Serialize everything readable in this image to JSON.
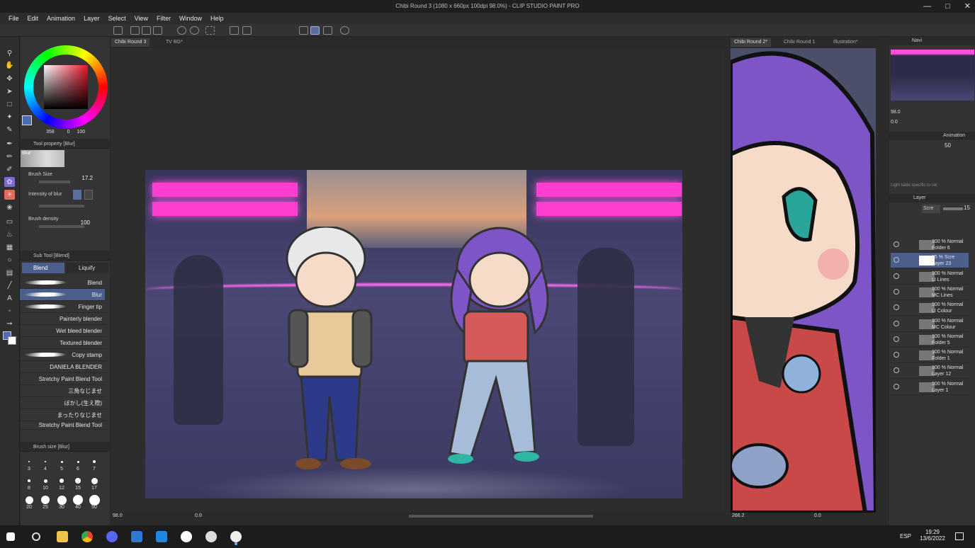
{
  "window": {
    "title": "Chibi Round 3 (1080 x 660px 100dpi 98.0%) - CLIP STUDIO PAINT PRO"
  },
  "menu": [
    "File",
    "Edit",
    "Animation",
    "Layer",
    "Select",
    "View",
    "Filter",
    "Window",
    "Help"
  ],
  "tabs": {
    "left": [
      "Chibi Round 3",
      "TV BG*"
    ],
    "right": [
      "Chibi Round 2*",
      "Chibi Round 1",
      "Illustration*"
    ]
  },
  "color": {
    "h": "358",
    "s": "0",
    "v": "100",
    "accent": "#e8132a"
  },
  "tool_property": {
    "title": "Tool property [Blur]",
    "tool": "Blur",
    "brush_size_label": "Brush Size",
    "brush_size": "17.2",
    "intensity_label": "Intensity of blur",
    "density_label": "Brush density",
    "density": "100"
  },
  "sub_tool": {
    "title": "Sub Tool [Blend]",
    "tabs": [
      "Blend",
      "Liquify"
    ],
    "items": [
      "Blend",
      "Blur",
      "Finger tip",
      "Painterly blender",
      "Wet bleed blender",
      "Textured blender",
      "Copy stamp",
      "DANIELA BLENDER",
      "Stretchy Paint Blend Tool",
      "三角なじませ",
      "ぼかし(生え際)",
      "まったりなじませ",
      "Stretchy Paint Blend Tool"
    ]
  },
  "brush_size": {
    "title": "Brush size [Blur]",
    "sizes": [
      "3",
      "4",
      "5",
      "6",
      "7",
      "8",
      "10",
      "12",
      "15",
      "17",
      "20",
      "25",
      "30",
      "40",
      "50"
    ]
  },
  "status": {
    "zoom": "98.0",
    "angle": "0.0",
    "zoom_right": "266.2",
    "angle_right": "0.0"
  },
  "navigator": {
    "tab": "Navi",
    "zoom": "98.0",
    "angle": "0.0"
  },
  "animation": {
    "tab": "Animation",
    "value": "50",
    "hint": "Light table specific to cel"
  },
  "layers": {
    "tab": "Layer",
    "blend": "Scre",
    "opacity": "15",
    "items": [
      {
        "pct": "100 %",
        "mode": "Normal",
        "name": "Folder 6"
      },
      {
        "pct": "15 %",
        "mode": "Scre",
        "name": "Layer 23"
      },
      {
        "pct": "100 %",
        "mode": "Normal",
        "name": "LI Lines"
      },
      {
        "pct": "100 %",
        "mode": "Normal",
        "name": "MC Lines"
      },
      {
        "pct": "100 %",
        "mode": "Normal",
        "name": "LI Colour"
      },
      {
        "pct": "100 %",
        "mode": "Normal",
        "name": "MC Colour"
      },
      {
        "pct": "100 %",
        "mode": "Normal",
        "name": "Folder 5"
      },
      {
        "pct": "100 %",
        "mode": "Normal",
        "name": "Folder 1"
      },
      {
        "pct": "100 %",
        "mode": "Normal",
        "name": "Layer 12"
      },
      {
        "pct": "100 %",
        "mode": "Normal",
        "name": "Layer 1"
      }
    ]
  },
  "taskbar": {
    "lang": "ESP",
    "time": "19:29",
    "date": "13/6/2022"
  }
}
